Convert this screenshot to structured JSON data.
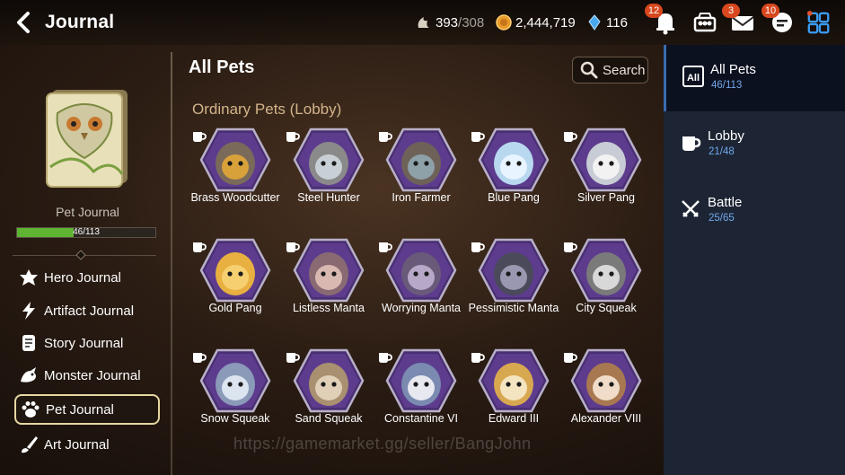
{
  "header": {
    "title": "Journal",
    "stamina": {
      "value": "393",
      "max": "/308"
    },
    "gold": "2,444,719",
    "crystal": "116",
    "notifications_badge": "12",
    "mail_badge": "3",
    "chat_badge": "10"
  },
  "sidebar": {
    "book_label": "Pet Journal",
    "progress_text": "46/113",
    "progress_fraction": 0.407,
    "items": [
      {
        "label": "Hero Journal",
        "icon": "hero-icon"
      },
      {
        "label": "Artifact Journal",
        "icon": "lightning-icon"
      },
      {
        "label": "Story Journal",
        "icon": "scroll-icon"
      },
      {
        "label": "Monster Journal",
        "icon": "dragon-icon"
      },
      {
        "label": "Pet Journal",
        "icon": "paw-icon"
      },
      {
        "label": "Art Journal",
        "icon": "brush-icon"
      }
    ]
  },
  "main": {
    "title": "All Pets",
    "search_label": "Search",
    "section_title": "Ordinary Pets (Lobby)",
    "pets": [
      {
        "name": "Brass Woodcutter",
        "color": "#7a6a5a",
        "face": "#d8a13a"
      },
      {
        "name": "Steel Hunter",
        "color": "#8a8a8a",
        "face": "#c8d0d6"
      },
      {
        "name": "Iron Farmer",
        "color": "#6e6258",
        "face": "#8ea0a8"
      },
      {
        "name": "Blue Pang",
        "color": "#b8d8f0",
        "face": "#e8f4ff"
      },
      {
        "name": "Silver Pang",
        "color": "#c8ccd4",
        "face": "#f2f2f2"
      },
      {
        "name": "Gold Pang",
        "color": "#e8b040",
        "face": "#f6d070"
      },
      {
        "name": "Listless Manta",
        "color": "#8a6a72",
        "face": "#d8b8b0"
      },
      {
        "name": "Worrying Manta",
        "color": "#6a5a7a",
        "face": "#b8a8c8"
      },
      {
        "name": "Pessimistic Manta",
        "color": "#4a4a5a",
        "face": "#9a98b0"
      },
      {
        "name": "City Squeak",
        "color": "#7a7a7a",
        "face": "#d8d8d8"
      },
      {
        "name": "Snow Squeak",
        "color": "#8a9ab8",
        "face": "#dce4f0"
      },
      {
        "name": "Sand Squeak",
        "color": "#a89070",
        "face": "#e0d0b8"
      },
      {
        "name": "Constantine VI",
        "color": "#7a8ab0",
        "face": "#e8e8f0"
      },
      {
        "name": "Edward III",
        "color": "#d8a850",
        "face": "#f4e4c0"
      },
      {
        "name": "Alexander VIII",
        "color": "#a87850",
        "face": "#f0dcc8"
      }
    ]
  },
  "tabs": [
    {
      "label": "All Pets",
      "count": "46/113"
    },
    {
      "label": "Lobby",
      "count": "21/48"
    },
    {
      "label": "Battle",
      "count": "25/65"
    }
  ],
  "watermark": "https://gamemarket.gg/seller/BangJohn"
}
